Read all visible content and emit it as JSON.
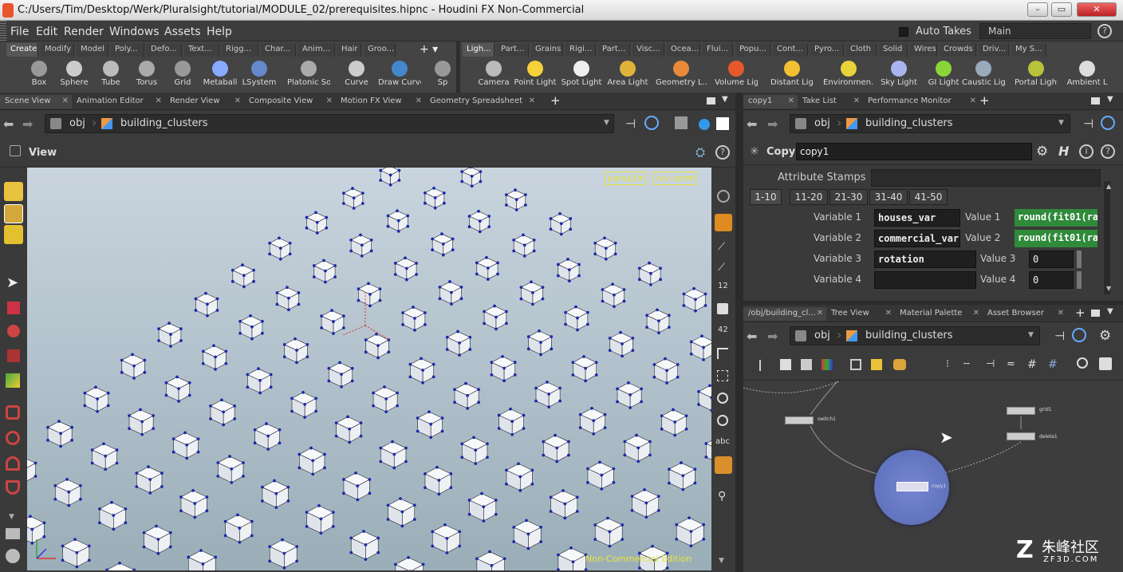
{
  "window": {
    "title": "C:/Users/Tim/Desktop/Werk/Pluralsight/tutorial/MODULE_02/prerequisites.hipnc - Houdini FX Non-Commercial",
    "controls": [
      "–",
      "▭",
      "✕"
    ]
  },
  "menu": [
    "File",
    "Edit",
    "Render",
    "Windows",
    "Assets",
    "Help"
  ],
  "takes": {
    "label": "Auto Takes",
    "desktop": "Main"
  },
  "shelf_tabs_left": [
    "Create",
    "Modify",
    "Model",
    "Poly...",
    "Defo...",
    "Text...",
    "Rigg...",
    "Char...",
    "Anim...",
    "Hair",
    "Groo..."
  ],
  "shelf_tabs_right": [
    "Ligh...",
    "Part...",
    "Grains",
    "Rigi...",
    "Part...",
    "Visc...",
    "Ocea...",
    "Flui...",
    "Popu...",
    "Cont...",
    "Pyro...",
    "Cloth",
    "Solid",
    "Wires",
    "Crowds",
    "Driv...",
    "My S..."
  ],
  "tools_left": [
    "Box",
    "Sphere",
    "Tube",
    "Torus",
    "Grid",
    "Metaball",
    "LSystem",
    "Platonic Sol...",
    "Curve",
    "Draw Curve",
    "Sp"
  ],
  "tools_right": [
    "Camera",
    "Point Light",
    "Spot Light",
    "Area Light",
    "Geometry L...",
    "Volume Light",
    "Distant Light",
    "Environmen...",
    "Sky Light",
    "GI Light",
    "Caustic Light",
    "Portal Light",
    "Ambient L"
  ],
  "left_panel": {
    "tabs": [
      "Scene View",
      "Animation Editor",
      "Render View",
      "Composite View",
      "Motion FX View",
      "Geometry Spreadsheet"
    ],
    "path": [
      "obj",
      "building_clusters"
    ],
    "view_label": "View",
    "persp": "persp1▾",
    "cam": "no cam▾",
    "watermark": "Non-Commercial Edition",
    "side_labels": [
      "12",
      "42",
      "abc"
    ]
  },
  "param_panel": {
    "tabs": [
      "copy1",
      "Take List",
      "Performance Monitor"
    ],
    "path": [
      "obj",
      "building_clusters"
    ],
    "node_type": "Copy",
    "node_name": "copy1",
    "attr_label": "Attribute Stamps",
    "range_tabs": [
      "1-10",
      "11-20",
      "21-30",
      "31-40",
      "41-50"
    ],
    "rows": [
      {
        "label": "Variable 1",
        "var": "houses_var",
        "vlabel": "Value 1",
        "value": "round(fit01(ra",
        "green": true
      },
      {
        "label": "Variable 2",
        "var": "commercial_var",
        "vlabel": "Value 2",
        "value": "round(fit01(ra",
        "green": true
      },
      {
        "label": "Variable 3",
        "var": "rotation",
        "vlabel": "Value 3",
        "value": "0",
        "green": false
      },
      {
        "label": "Variable 4",
        "var": "",
        "vlabel": "Value 4",
        "value": "0",
        "green": false
      }
    ]
  },
  "network_panel": {
    "tabs": [
      "/obj/building_cl...",
      "Tree View",
      "Material Palette",
      "Asset Browser"
    ],
    "path": [
      "obj",
      "building_clusters"
    ],
    "nodes": [
      "switch1",
      "grid1",
      "delete1",
      "copy1"
    ]
  },
  "site_watermark": {
    "text": "朱峰社区",
    "sub": "ZF3D.COM"
  }
}
